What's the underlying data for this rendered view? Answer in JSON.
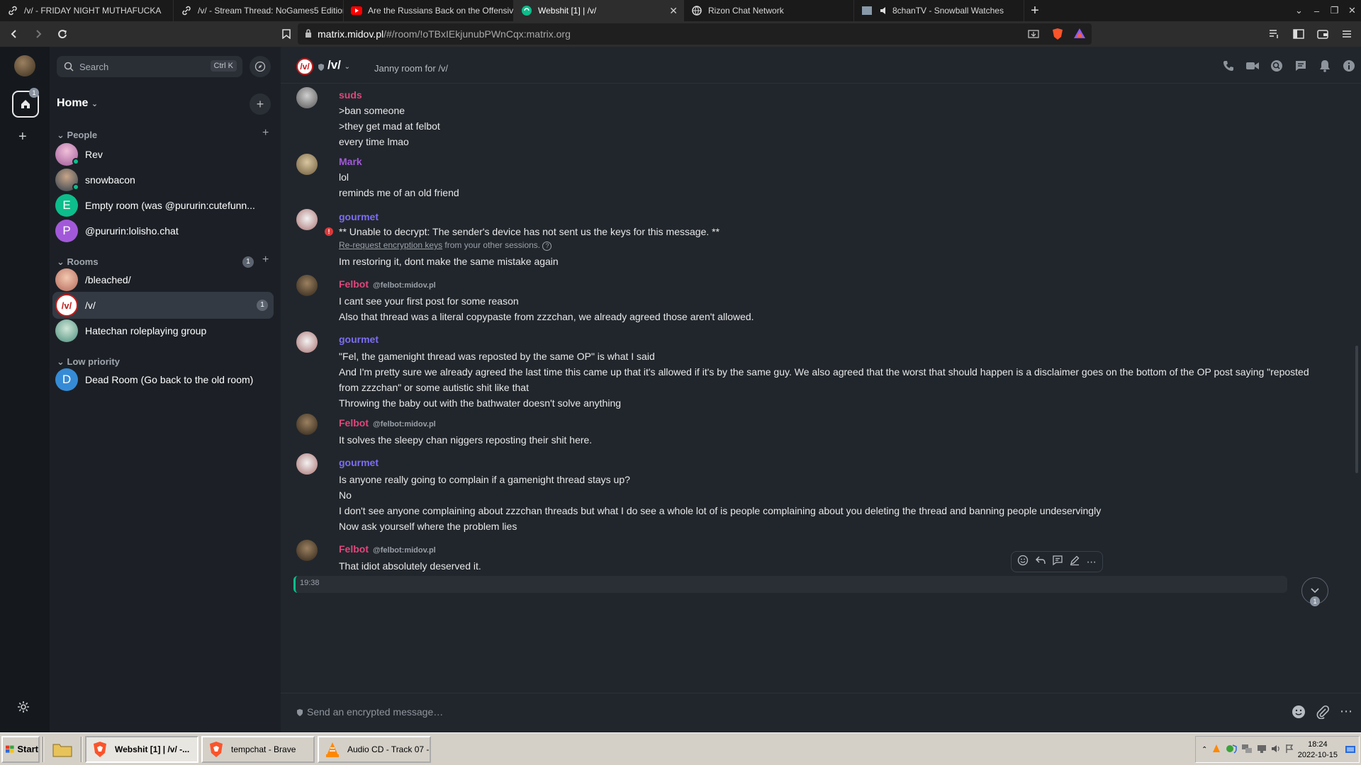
{
  "browser": {
    "tabs": [
      {
        "title": "/v/ - FRIDAY NIGHT MUTHAFUCKA",
        "icon": "link-icon"
      },
      {
        "title": "/v/ - Stream Thread: NoGames5 Edition",
        "icon": "link-icon"
      },
      {
        "title": "Are the Russians Back on the Offensive?!",
        "icon": "youtube-icon"
      },
      {
        "title": "Webshit [1] | /v/",
        "icon": "element-icon",
        "active": true
      },
      {
        "title": "Rizon Chat Network",
        "icon": "globe-icon"
      },
      {
        "title": "8chanTV - Snowball Watches",
        "icon": "speaker-icon"
      }
    ],
    "url_host": "matrix.midov.pl",
    "url_path": "/#/room/!oTBxIEkjunubPWnCqx:matrix.org"
  },
  "spaces": {
    "home_badge": "1"
  },
  "sidebar": {
    "search_placeholder": "Search",
    "search_shortcut": "Ctrl K",
    "home_title": "Home",
    "people_header": "People",
    "people": [
      {
        "name": "Rev",
        "avatar_color": "#c06ab0",
        "online": true
      },
      {
        "name": "snowbacon",
        "avatar_color": "#4d6a80",
        "online": true
      },
      {
        "name": "Empty room (was @pururin:cutefunn...",
        "letter": "E",
        "avatar_color": "#0dbd8b"
      },
      {
        "name": "@pururin:lolisho.chat",
        "letter": "P",
        "avatar_color": "#a259d9"
      }
    ],
    "rooms_header": "Rooms",
    "rooms_count": "1",
    "rooms": [
      {
        "name": "/bleached/",
        "avatar_color": "#d98c7a"
      },
      {
        "name": "/v/",
        "avatar_color": "#ffffff",
        "badge": "1",
        "selected": true
      },
      {
        "name": "Hatechan roleplaying group",
        "avatar_color": "#6fae9b"
      }
    ],
    "lowpri_header": "Low priority",
    "lowpri": [
      {
        "name": "Dead Room (Go back to the old room)",
        "letter": "D",
        "avatar_color": "#368bd6"
      }
    ]
  },
  "room": {
    "name": "/v/",
    "topic": "Janny room for /v/",
    "composer_placeholder": "Send an encrypted message…"
  },
  "colors": {
    "suds": "#e0477b",
    "mark": "#a259d9",
    "gourmet": "#7c6ef2",
    "felbot": "#e0477b",
    "accent": "#0dbd8b"
  },
  "timeline": {
    "e1": {
      "sender": "suds",
      "lines": [
        ">ban someone",
        ">they get mad at felbot",
        "every time lmao"
      ]
    },
    "e2": {
      "sender": "Mark",
      "lines": [
        "lol",
        "reminds me of an old friend"
      ]
    },
    "e3": {
      "sender": "gourmet",
      "error": "** Unable to decrypt: The sender's device has not sent us the keys for this message. **",
      "rerequest_link": "Re-request encryption keys",
      "rerequest_rest": " from your other sessions.",
      "lines": [
        "Im restoring it, dont make the same mistake again"
      ]
    },
    "e4": {
      "sender": "Felbot",
      "mxid": "@felbot:midov.pl",
      "lines": [
        "I cant see your first post for some reason",
        "Also that thread was a literal copypaste from zzzchan, we already agreed those aren't allowed."
      ]
    },
    "e5": {
      "sender": "gourmet",
      "lines": [
        "\"Fel, the gamenight thread was reposted by the same OP\" is what I said",
        "And I'm pretty sure we already agreed the last time this came up that it's allowed if it's by the same guy. We also agreed that the worst that should happen is a disclaimer goes on the bottom of the OP post saying \"reposted from zzzchan\" or some autistic shit like that",
        "Throwing the baby out with the bathwater doesn't solve anything"
      ]
    },
    "e6": {
      "sender": "Felbot",
      "mxid": "@felbot:midov.pl",
      "lines": [
        "It solves the sleepy chan niggers reposting their shit here."
      ]
    },
    "e7": {
      "sender": "gourmet",
      "lines": [
        "Is anyone really going to complain if a gamenight thread stays up?",
        "No",
        "I don't see anyone complaining about zzzchan threads but what I do see a whole lot of is people complaining about you deleting the thread and banning people undeservingly",
        "Now ask yourself where the problem lies"
      ]
    },
    "e8": {
      "sender": "Felbot",
      "mxid": "@felbot:midov.pl",
      "time": "19:38",
      "lines": [
        "That idiot absolutely deserved it."
      ]
    }
  },
  "jump_badge": "1",
  "taskbar": {
    "start": "Start",
    "tasks": [
      {
        "label": "Webshit [1] | /v/ -...",
        "icon": "brave-icon",
        "active": true
      },
      {
        "label": "tempchat - Brave",
        "icon": "brave-icon"
      },
      {
        "label": "Audio CD - Track 07 -...",
        "icon": "vlc-icon"
      }
    ],
    "time": "18:24",
    "date": "2022-10-15"
  }
}
